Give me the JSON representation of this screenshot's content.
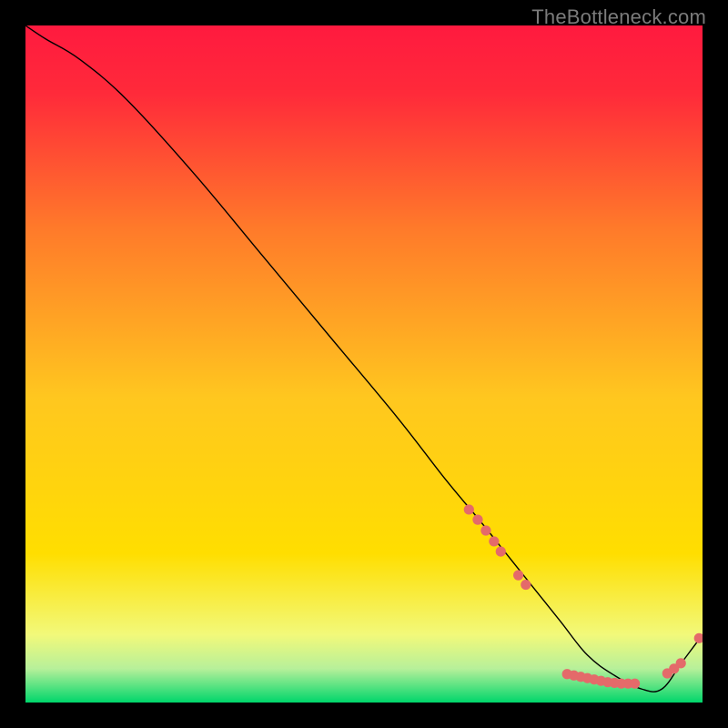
{
  "watermark": "TheBottleneck.com",
  "chart_data": {
    "type": "line",
    "title": "",
    "xlabel": "",
    "ylabel": "",
    "xlim": [
      0,
      100
    ],
    "ylim": [
      0,
      100
    ],
    "grid": false,
    "background_gradient": {
      "top": "#ff1a3f",
      "mid": "#ffde00",
      "bottom": "#00d66b"
    },
    "series": [
      {
        "name": "curve",
        "x": [
          0,
          3,
          8,
          15,
          25,
          35,
          45,
          55,
          62,
          67,
          71,
          75,
          79,
          83,
          87,
          91,
          94,
          97,
          100
        ],
        "y": [
          100,
          98,
          95,
          89,
          78,
          66,
          54,
          42,
          33,
          27,
          22,
          17,
          12,
          7,
          4,
          2,
          2,
          6,
          10
        ],
        "stroke": "#000000",
        "stroke_width": 1.4
      }
    ],
    "markers": [
      {
        "name": "dots",
        "color": "#e46a6a",
        "radius": 5.6,
        "points": [
          {
            "x": 65.5,
            "y": 28.5
          },
          {
            "x": 66.8,
            "y": 27.0
          },
          {
            "x": 68.0,
            "y": 25.4
          },
          {
            "x": 69.2,
            "y": 23.8
          },
          {
            "x": 70.2,
            "y": 22.3
          },
          {
            "x": 72.8,
            "y": 18.8
          },
          {
            "x": 73.9,
            "y": 17.4
          },
          {
            "x": 80.0,
            "y": 4.2
          },
          {
            "x": 81.0,
            "y": 4.0
          },
          {
            "x": 82.0,
            "y": 3.8
          },
          {
            "x": 83.0,
            "y": 3.6
          },
          {
            "x": 84.0,
            "y": 3.4
          },
          {
            "x": 85.0,
            "y": 3.2
          },
          {
            "x": 86.0,
            "y": 3.0
          },
          {
            "x": 87.0,
            "y": 2.9
          },
          {
            "x": 88.0,
            "y": 2.8
          },
          {
            "x": 89.0,
            "y": 2.8
          },
          {
            "x": 90.0,
            "y": 2.8
          },
          {
            "x": 94.8,
            "y": 4.3
          },
          {
            "x": 95.8,
            "y": 5.0
          },
          {
            "x": 96.8,
            "y": 5.8
          },
          {
            "x": 99.5,
            "y": 9.5
          }
        ]
      }
    ]
  }
}
